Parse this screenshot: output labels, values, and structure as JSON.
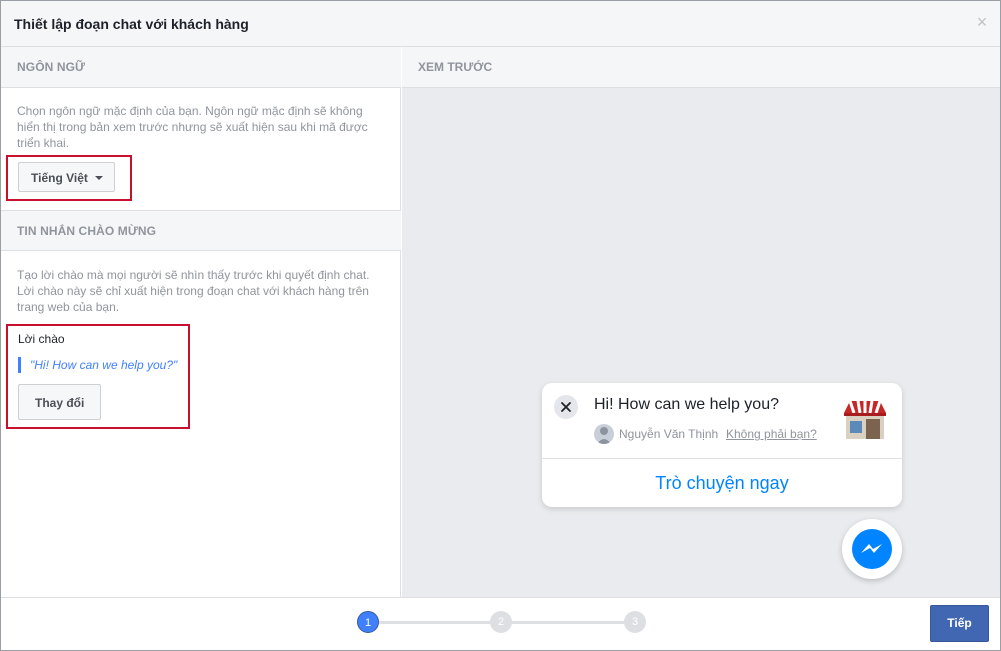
{
  "dialog": {
    "title": "Thiết lập đoạn chat với khách hàng",
    "close_glyph": "×"
  },
  "language": {
    "heading": "NGÔN NGỮ",
    "description": "Chọn ngôn ngữ mặc định của bạn. Ngôn ngữ mặc định sẽ không hiển thị trong bản xem trước nhưng sẽ xuất hiện sau khi mã được triển khai.",
    "selected": "Tiếng Việt"
  },
  "welcome": {
    "heading": "TIN NHẮN CHÀO MỪNG",
    "description": "Tạo lời chào mà mọi người sẽ nhìn thấy trước khi quyết định chat. Lời chào này sẽ chỉ xuất hiện trong đoạn chat với khách hàng trên trang web của bạn.",
    "greeting_label": "Lời chào",
    "greeting_text": "\"Hi! How can we help you?\"",
    "change_button": "Thay đổi"
  },
  "preview": {
    "heading": "XEM TRƯỚC",
    "greeting": "Hi! How can we help you?",
    "user_name": "Nguyễn Văn Thịnh",
    "not_you_link": "Không phải bạn?",
    "chat_now": "Trò chuyện ngay"
  },
  "footer": {
    "steps": [
      "1",
      "2",
      "3"
    ],
    "current_step": 1,
    "next_button": "Tiếp"
  },
  "colors": {
    "accent": "#4267b2",
    "step_active": "#4080ff",
    "messenger_blue": "#0084ff",
    "highlight_box": "#c8102e"
  },
  "icons": {
    "close": "close-icon",
    "dropdown": "caret-down-icon",
    "shop": "shop-icon",
    "messenger": "messenger-icon"
  }
}
